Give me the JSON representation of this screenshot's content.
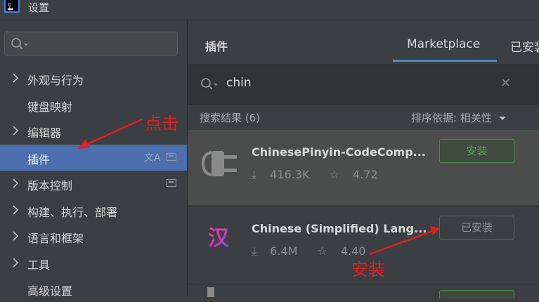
{
  "window": {
    "title": "设置"
  },
  "sidebar": {
    "items": [
      {
        "label": "外观与行为",
        "expandable": true
      },
      {
        "label": "键盘映射",
        "expandable": false
      },
      {
        "label": "编辑器",
        "expandable": true
      },
      {
        "label": "插件",
        "expandable": false,
        "selected": true
      },
      {
        "label": "版本控制",
        "expandable": true
      },
      {
        "label": "构建、执行、部署",
        "expandable": true
      },
      {
        "label": "语言和框架",
        "expandable": true
      },
      {
        "label": "工具",
        "expandable": true
      },
      {
        "label": "高级设置",
        "expandable": false
      }
    ]
  },
  "header": {
    "title": "插件",
    "tabs": [
      {
        "label": "Marketplace",
        "active": true
      },
      {
        "label": "已安装"
      }
    ]
  },
  "search": {
    "value": "chin"
  },
  "results": {
    "count_label": "搜索结果 (6)",
    "sort_label": "排序依据: 相关性"
  },
  "plugins": [
    {
      "name": "ChinesePinyin-CodeComp...",
      "downloads": "416.3K",
      "rating": "4.72",
      "button": "安装",
      "installed": false
    },
    {
      "name": "Chinese (Simplified) Lang...",
      "downloads": "6.4M",
      "rating": "4.40",
      "button": "已安装",
      "installed": true,
      "icon_glyph": "汉"
    }
  ],
  "annotations": {
    "click": "点击",
    "install": "安装"
  },
  "colors": {
    "accent": "#4a88c7",
    "selected": "#4b6eaf",
    "annotation": "#e02020",
    "install_green": "#4c8c4a"
  }
}
